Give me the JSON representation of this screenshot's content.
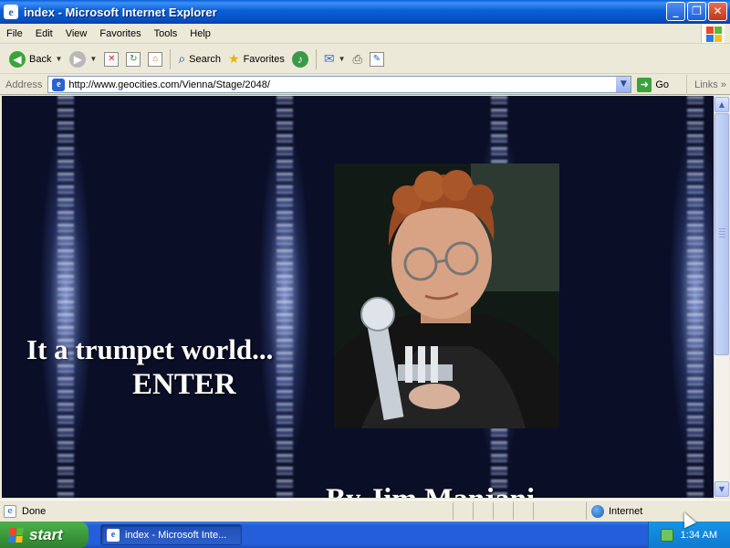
{
  "window": {
    "title": "index - Microsoft Internet Explorer",
    "controls": {
      "minimize": "_",
      "maximize": "❐",
      "close": "✕"
    }
  },
  "menu": [
    "File",
    "Edit",
    "View",
    "Favorites",
    "Tools",
    "Help"
  ],
  "toolbar": {
    "back_label": "Back",
    "search_label": "Search",
    "favorites_label": "Favorites"
  },
  "address": {
    "label": "Address",
    "url": "http://www.geocities.com/Vienna/Stage/2048/",
    "go_label": "Go",
    "links_label": "Links"
  },
  "page": {
    "headline": "It a trumpet world...",
    "enter_link": "ENTER",
    "byline": "By Jim Manjani"
  },
  "status": {
    "text": "Done",
    "zone": "Internet"
  },
  "taskbar": {
    "start_label": "start",
    "task_label": "index - Microsoft Inte...",
    "clock": "1:34 AM"
  },
  "icons": {
    "back": "back-arrow-icon",
    "forward": "forward-arrow-icon",
    "stop": "stop-icon",
    "refresh": "refresh-icon",
    "home": "home-icon",
    "search": "search-icon",
    "favorites": "star-icon",
    "media": "media-icon",
    "mail": "mail-icon",
    "print": "print-icon",
    "edit": "edit-icon"
  },
  "colors": {
    "title_bar": "#0a5fd8",
    "taskbar": "#245edb",
    "start_button": "#3c9a3c",
    "page_background": "#0a0e26"
  }
}
